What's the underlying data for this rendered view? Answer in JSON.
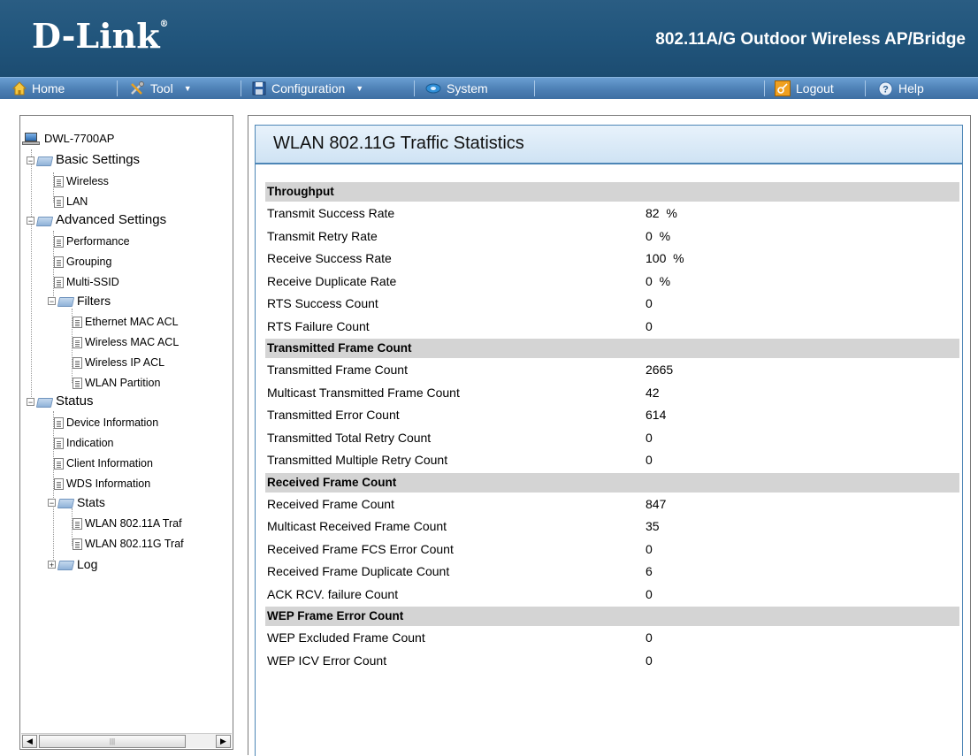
{
  "header": {
    "logo": "D-Link",
    "product_title": "802.11A/G Outdoor Wireless AP/Bridge"
  },
  "menu": {
    "home": "Home",
    "tool": "Tool",
    "configuration": "Configuration",
    "system": "System",
    "logout": "Logout",
    "help": "Help"
  },
  "tree": {
    "root": "DWL-7700AP",
    "basic_settings": "Basic Settings",
    "wireless": "Wireless",
    "lan": "LAN",
    "advanced_settings": "Advanced Settings",
    "performance": "Performance",
    "grouping": "Grouping",
    "multi_ssid": "Multi-SSID",
    "filters": "Filters",
    "ethernet_mac_acl": "Ethernet MAC ACL",
    "wireless_mac_acl": "Wireless MAC ACL",
    "wireless_ip_acl": "Wireless IP ACL",
    "wlan_partition": "WLAN Partition",
    "status": "Status",
    "device_information": "Device Information",
    "indication": "Indication",
    "client_information": "Client Information",
    "wds_information": "WDS Information",
    "stats": "Stats",
    "wlan_a_traffic": "WLAN 802.11A Traf",
    "wlan_g_traffic": "WLAN 802.11G Traf",
    "log": "Log"
  },
  "panel_title": "WLAN 802.11G Traffic Statistics",
  "sections": {
    "throughput": {
      "title": "Throughput",
      "rows": [
        {
          "label": "Transmit Success Rate",
          "value": "82  %"
        },
        {
          "label": "Transmit Retry Rate",
          "value": "0  %"
        },
        {
          "label": "Receive Success Rate",
          "value": "100  %"
        },
        {
          "label": "Receive Duplicate Rate",
          "value": "0  %"
        },
        {
          "label": "RTS Success Count",
          "value": "0"
        },
        {
          "label": "RTS Failure Count",
          "value": "0"
        }
      ]
    },
    "transmitted": {
      "title": "Transmitted Frame Count",
      "rows": [
        {
          "label": "Transmitted Frame Count",
          "value": "2665"
        },
        {
          "label": "Multicast Transmitted Frame Count",
          "value": "42"
        },
        {
          "label": "Transmitted Error Count",
          "value": "614"
        },
        {
          "label": "Transmitted Total Retry Count",
          "value": "0"
        },
        {
          "label": "Transmitted Multiple Retry Count",
          "value": "0"
        }
      ]
    },
    "received": {
      "title": "Received Frame Count",
      "rows": [
        {
          "label": "Received Frame Count",
          "value": "847"
        },
        {
          "label": "Multicast Received Frame Count",
          "value": "35"
        },
        {
          "label": "Received Frame FCS Error Count",
          "value": "0"
        },
        {
          "label": "Received Frame Duplicate Count",
          "value": "6"
        },
        {
          "label": "ACK RCV. failure Count",
          "value": "0"
        }
      ]
    },
    "wep": {
      "title": "WEP Frame Error Count",
      "rows": [
        {
          "label": "WEP Excluded Frame Count",
          "value": "0"
        },
        {
          "label": "WEP ICV Error Count",
          "value": "0"
        }
      ]
    }
  }
}
